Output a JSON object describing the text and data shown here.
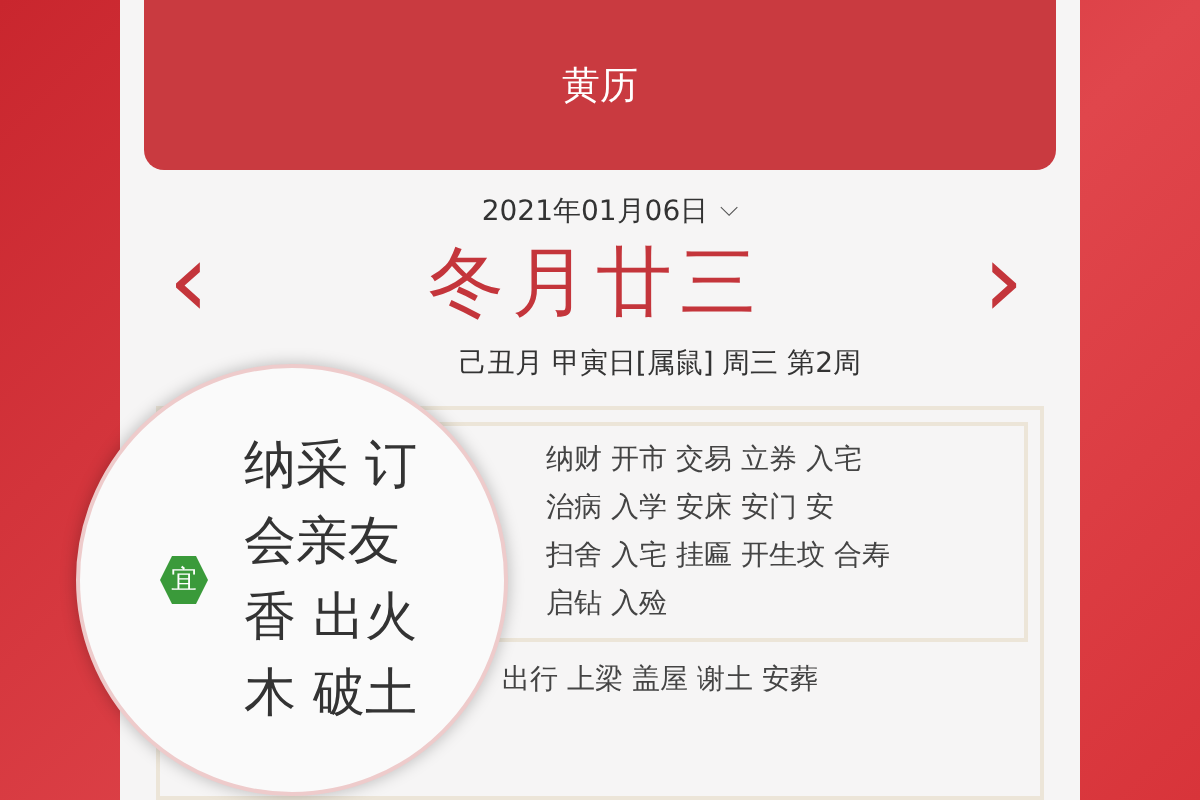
{
  "header": {
    "title": "黄历"
  },
  "date": {
    "value": "2021年01月06日",
    "dropdown_icon": "⌵"
  },
  "lunar": {
    "prev": "‹",
    "day": "冬月廿三",
    "next": "›"
  },
  "info": "己丑月 甲寅日[属鼠] 周三 第2周",
  "yi": {
    "lines": [
      "纳财 开市 交易 立券 入宅",
      "治病 入学 安床 安门 安",
      "扫舍 入宅 挂匾 开生坟 合寿",
      "启钻 入殓"
    ]
  },
  "ji": {
    "text": "出行 上梁 盖屋 谢土 安葬"
  },
  "magnifier": {
    "badge": "宜",
    "lines": [
      "纳采 订",
      "会亲友",
      "香 出火",
      "木 破土"
    ]
  }
}
